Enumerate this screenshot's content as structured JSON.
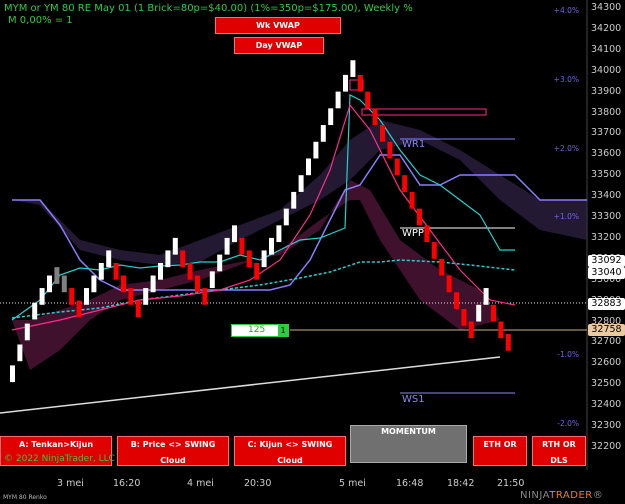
{
  "header": {
    "line1": "MYM or YM 80 RE May 01 (1 Brick=80p=$40.00) (1%=350p=$175.00), Weekly %",
    "line2": "M 0,00% = 1"
  },
  "vwap_buttons": {
    "wk": "Wk VWAP",
    "day": "Day VWAP"
  },
  "percent_labels": [
    "+4.0%",
    "+3.0%",
    "+2.0%",
    "+1.0%",
    "-1.0%",
    "-2.0%"
  ],
  "y_ticks": [
    "34300",
    "34200",
    "34100",
    "34000",
    "33900",
    "33800",
    "33700",
    "33600",
    "33500",
    "33400",
    "33300",
    "33200",
    "33100",
    "33000",
    "32900",
    "32800",
    "32700",
    "32600",
    "32500",
    "32400",
    "32300",
    "32200"
  ],
  "price_badges": [
    {
      "label": "33092",
      "bg": "#ffffff",
      "fg": "#000000"
    },
    {
      "label": "33040",
      "bg": "#ffffff",
      "fg": "#000000"
    },
    {
      "label": "32883",
      "bg": "#ffffff",
      "fg": "#000000"
    },
    {
      "label": "32758",
      "bg": "#e8c9a0",
      "fg": "#000000"
    }
  ],
  "x_ticks": [
    "3 mei",
    "16:20",
    "4 mei",
    "20:30",
    "5 mei",
    "16:48",
    "18:42",
    "21:50"
  ],
  "levels": {
    "wr1": "WR1",
    "wpp": "WPP",
    "ws1": "WS1"
  },
  "order": {
    "quantity": "125",
    "badge": "1"
  },
  "bottom_buttons": [
    {
      "label": "A: Tenkan>Kijun"
    },
    {
      "label": "B: Price <> SWING Cloud"
    },
    {
      "label": "C: Kijun <> SWING Cloud"
    },
    {
      "label": "ETH OR"
    },
    {
      "label": "RTH OR DLS"
    }
  ],
  "momentum_label": "MOMENTUM",
  "copyright": "© 2022 NinjaTrader, LLC",
  "footer_instrument": "MYM 80 Renko",
  "logo": {
    "part1": "NINJA",
    "part2": "TRADER",
    "suffix": "®"
  },
  "colors": {
    "up_brick": "#ffffff",
    "down_brick": "#ff0000",
    "neutral_brick": "#808080",
    "cloud": "#3a2a55",
    "kijun": "#8a7cff",
    "tenkan": "#24d0d0",
    "vwap": "#ff2a8a"
  },
  "chart_data": {
    "type": "renko",
    "price_range": [
      32200,
      34300
    ],
    "bricks_mid_prices": [
      32550,
      32650,
      32750,
      32850,
      32920,
      32980,
      33020,
      32980,
      32920,
      32860,
      32920,
      32980,
      33040,
      33100,
      33040,
      32980,
      32920,
      32860,
      32920,
      32980,
      33040,
      33100,
      33160,
      33100,
      33040,
      32980,
      32920,
      33000,
      33080,
      33160,
      33220,
      33160,
      33100,
      33040,
      33100,
      33160,
      33220,
      33300,
      33380,
      33460,
      33540,
      33620,
      33700,
      33780,
      33860,
      33940,
      34010,
      33940,
      33860,
      33780,
      33700,
      33620,
      33540,
      33460,
      33380,
      33300,
      33220,
      33140,
      33060,
      32980,
      32900,
      32820,
      32760,
      32840,
      32920,
      32840,
      32760,
      32700
    ]
  }
}
